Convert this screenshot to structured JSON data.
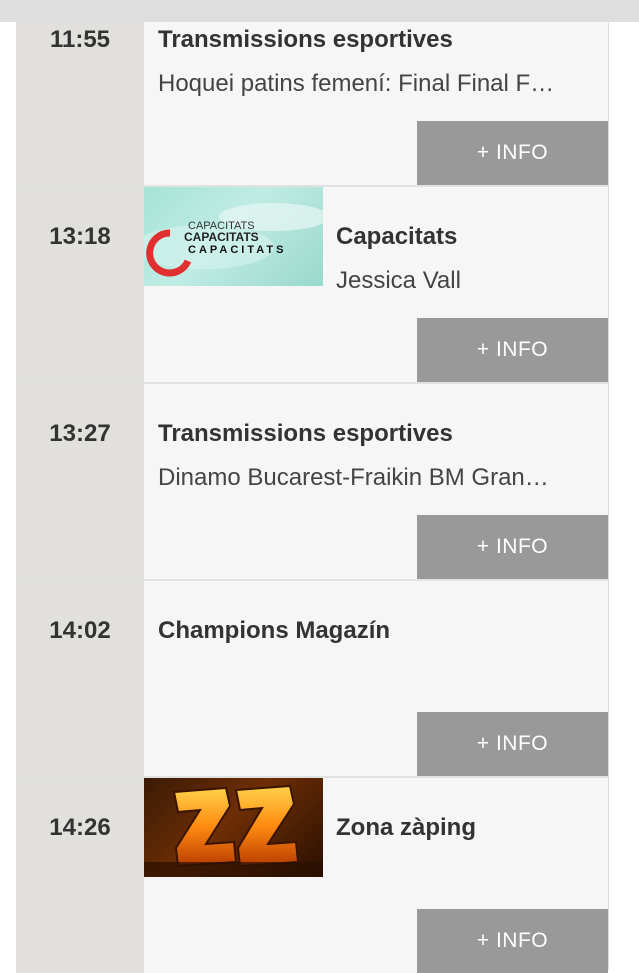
{
  "programs": [
    {
      "time": "11:55",
      "title": "Transmissions esportives",
      "subtitle": "Hoquei patins femení: Final Final F…",
      "info_label": "+ INFO",
      "image": null
    },
    {
      "time": "13:18",
      "title": "Capacitats",
      "subtitle": "Jessica Vall",
      "info_label": "+ INFO",
      "image": "capacitats-logo",
      "image_text": [
        "CAPACITATS",
        "CAPACITATS",
        "CAPACITATS"
      ]
    },
    {
      "time": "13:27",
      "title": "Transmissions esportives",
      "subtitle": "Dinamo Bucarest-Fraikin BM Gran…",
      "info_label": "+ INFO",
      "image": null
    },
    {
      "time": "14:02",
      "title": "Champions Magazín",
      "subtitle": "",
      "info_label": "+ INFO",
      "image": null
    },
    {
      "time": "14:26",
      "title": "Zona zàping",
      "subtitle": "",
      "info_label": "+ INFO",
      "image": "zona-zaping-logo"
    }
  ],
  "colors": {
    "info_button_bg": "#999999",
    "time_column_bg": "#e2e0dd",
    "row_bg": "#f6f6f6",
    "text_dark": "#333333"
  }
}
